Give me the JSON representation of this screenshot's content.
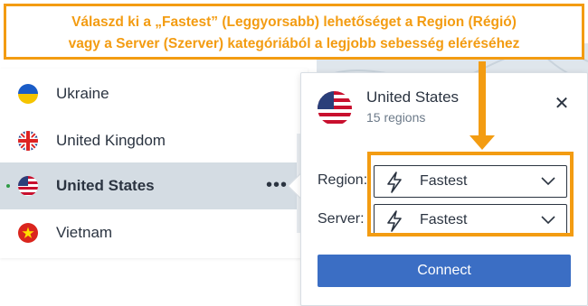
{
  "annotation": {
    "line1": "Válaszd ki a „Fastest” (Leggyorsabb) lehetőséget a Region (Régió)",
    "line2": "vagy a Server (Szerver) kategóriából a legjobb sebesség eléréséhez",
    "color": "#f39c12"
  },
  "country_list": {
    "items": [
      {
        "name": "Ukraine",
        "flag": "ukraine-flag-icon",
        "selected": false,
        "connected": false
      },
      {
        "name": "United Kingdom",
        "flag": "uk-flag-icon",
        "selected": false,
        "connected": false
      },
      {
        "name": "United States",
        "flag": "us-flag-icon",
        "selected": true,
        "connected": true
      },
      {
        "name": "Vietnam",
        "flag": "vietnam-flag-icon",
        "selected": false,
        "connected": false
      }
    ],
    "more_label": "•••"
  },
  "popover": {
    "country": "United States",
    "subtitle": "15 regions",
    "close_symbol": "✕",
    "region_label": "Region:",
    "region_value": "Fastest",
    "server_label": "Server:",
    "server_value": "Fastest",
    "connect_label": "Connect",
    "accent": "#3b6ec4"
  }
}
